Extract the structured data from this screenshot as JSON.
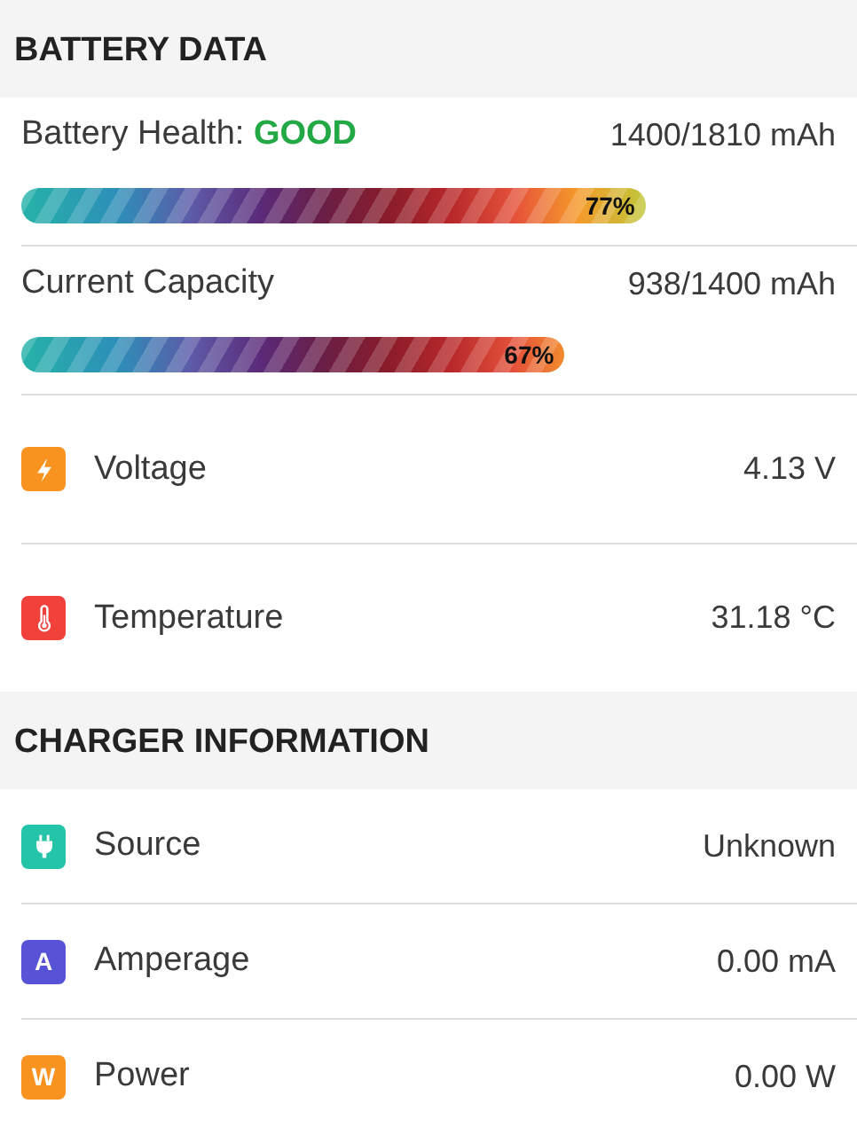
{
  "sections": [
    {
      "title": "BATTERY DATA",
      "rows": [
        {
          "kind": "meter",
          "label": "Battery Health: **GOOD**",
          "value": "1400/1810 mAh",
          "level": 0.77,
          "reading": "77%"
        },
        {
          "kind": "meter",
          "label": "Current Capacity",
          "value": "938/1400 mAh",
          "level": 0.67,
          "reading": "67%"
        },
        {
          "kind": "bolt",
          "color": "#f7931e",
          "label": "Voltage",
          "value": "4.13 V"
        },
        {
          "kind": "thermometer",
          "color": "#f0413a",
          "label": "Temperature",
          "value": "31.18 °C"
        }
      ]
    },
    {
      "title": "CHARGER INFORMATION",
      "rows": [
        {
          "kind": "plug",
          "color": "#23c4a8",
          "label": "Source",
          "value": "Unknown"
        },
        {
          "kind": "letter",
          "letter": "A",
          "color": "#5853d6",
          "label": "Amperage",
          "value": "0.00 mA"
        },
        {
          "kind": "letter",
          "letter": "W",
          "color": "#f7931e",
          "label": "Power",
          "value": "0.00 W"
        }
      ]
    }
  ]
}
